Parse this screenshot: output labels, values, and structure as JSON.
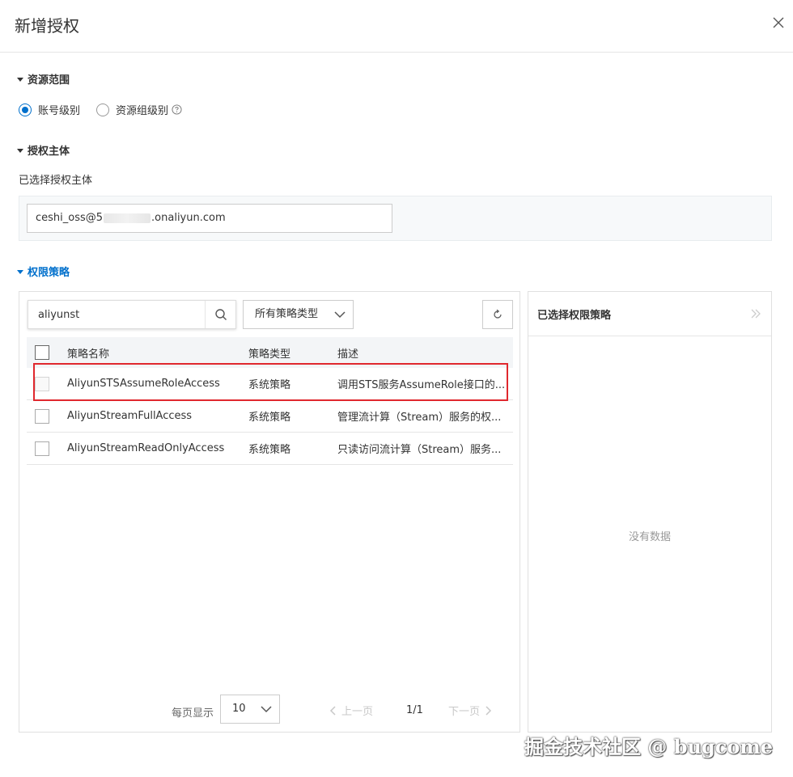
{
  "dialog": {
    "title": "新增授权"
  },
  "resource_scope": {
    "heading": "资源范围",
    "options": [
      {
        "label": "账号级别",
        "checked": true
      },
      {
        "label": "资源组级别",
        "checked": false
      }
    ]
  },
  "principal": {
    "heading": "授权主体",
    "sub_label": "已选择授权主体",
    "value_prefix": "ceshi_oss@5",
    "value_suffix": ".onaliyun.com"
  },
  "policies": {
    "heading": "权限策略",
    "search_value": "aliyunst",
    "type_select": "所有策略类型",
    "columns": [
      "策略名称",
      "策略类型",
      "描述"
    ],
    "rows": [
      {
        "name": "AliyunSTSAssumeRoleAccess",
        "type": "系统策略",
        "desc": "调用STS服务AssumeRole接口的..."
      },
      {
        "name": "AliyunStreamFullAccess",
        "type": "系统策略",
        "desc": "管理流计算（Stream）服务的权..."
      },
      {
        "name": "AliyunStreamReadOnlyAccess",
        "type": "系统策略",
        "desc": "只读访问流计算（Stream）服务..."
      }
    ],
    "pager": {
      "per_page_label": "每页显示",
      "page_size": "10",
      "prev": "上一页",
      "page_indicator": "1/1",
      "next": "下一页"
    }
  },
  "selected_panel": {
    "title": "已选择权限策略",
    "empty_text": "没有数据"
  },
  "watermark": "掘金技术社区 @ bugcome",
  "colors": {
    "accent": "#0070cc",
    "highlight": "#e0282e"
  }
}
